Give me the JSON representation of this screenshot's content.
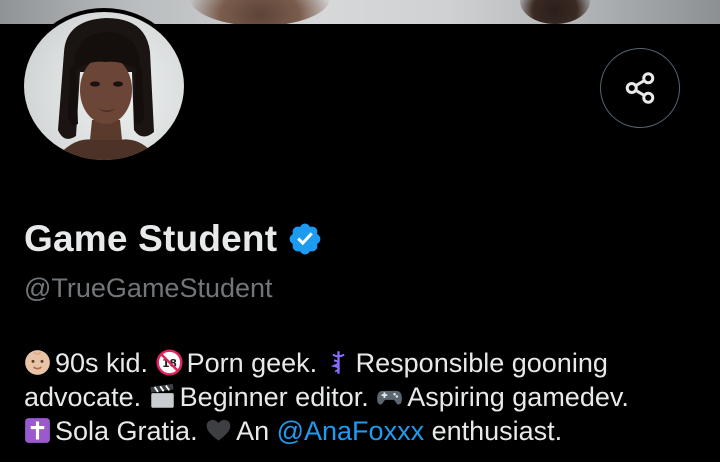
{
  "profile": {
    "display_name": "Game Student",
    "handle": "@TrueGameStudent",
    "verified": true,
    "accent_color": "#1d9bf0"
  },
  "bio": {
    "l1_a": "90s kid. ",
    "l1_b": "Porn geek. ",
    "l1_c": "Responsible gooning",
    "l2_a": "advocate. ",
    "l2_b": "Beginner editor. ",
    "l2_c": "Aspiring gamedev.",
    "l3_a": "Sola Gratia. ",
    "l3_b": "An ",
    "l3_mention": "@AnaFoxxx",
    "l3_c": " enthusiast."
  },
  "icons": {
    "bio_emojis": [
      "baby-face-icon",
      "no-under-18-icon",
      "caduceus-icon",
      "clapper-board-icon",
      "game-controller-icon",
      "latin-cross-icon",
      "black-heart-icon"
    ],
    "share": "share-icon",
    "verified": "verified-badge-icon"
  }
}
